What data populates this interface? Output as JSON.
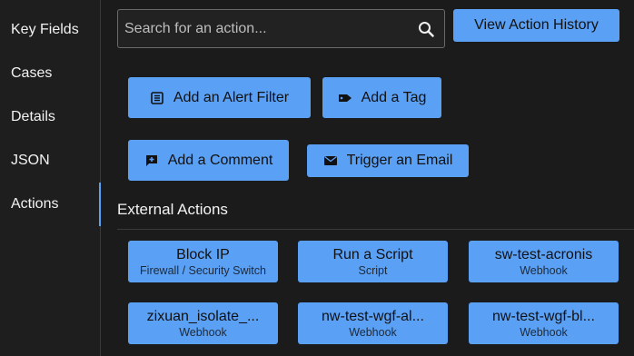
{
  "sidebar": {
    "items": [
      {
        "label": "Key Fields"
      },
      {
        "label": "Cases"
      },
      {
        "label": "Details"
      },
      {
        "label": "JSON"
      },
      {
        "label": "Actions",
        "active": true
      }
    ]
  },
  "search": {
    "placeholder": "Search for an action...",
    "value": ""
  },
  "header": {
    "view_history_label": "View Action History"
  },
  "actions": {
    "add_alert_filter": {
      "label": "Add an Alert Filter",
      "icon": "list-icon"
    },
    "add_tag": {
      "label": "Add a Tag",
      "icon": "tag-icon"
    },
    "add_comment": {
      "label": "Add a Comment",
      "icon": "comment-plus-icon"
    },
    "trigger_email": {
      "label": "Trigger an Email",
      "icon": "envelope-icon"
    }
  },
  "external": {
    "title": "External Actions",
    "items": [
      {
        "name": "Block IP",
        "type": "Firewall / Security Switch"
      },
      {
        "name": "Run a Script",
        "type": "Script"
      },
      {
        "name": "sw-test-acronis",
        "type": "Webhook"
      },
      {
        "name": "zixuan_isolate_...",
        "type": "Webhook"
      },
      {
        "name": "nw-test-wgf-al...",
        "type": "Webhook"
      },
      {
        "name": "nw-test-wgf-bl...",
        "type": "Webhook"
      }
    ]
  },
  "colors": {
    "accent": "#5aa0f5",
    "background": "#1b1b1b",
    "text": "#f2f2f2"
  }
}
